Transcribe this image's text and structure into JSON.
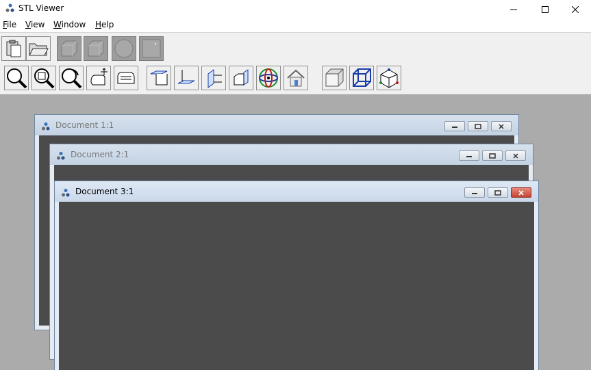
{
  "app": {
    "title": "STL Viewer"
  },
  "menu": [
    {
      "label": "File"
    },
    {
      "label": "View"
    },
    {
      "label": "Window"
    },
    {
      "label": "Help"
    }
  ],
  "toolbar1": [
    "paste-icon",
    "open-folder-icon",
    "box-gray-icon",
    "box-gray-icon",
    "sphere-gray-icon",
    "square-gray-icon"
  ],
  "toolbar2": [
    "zoom-icon",
    "zoom-window-icon",
    "zoom-dynamic-icon",
    "pan-icon",
    "rotate-hand-icon",
    "view-top-icon",
    "view-bottom-icon",
    "view-left-icon",
    "view-right-icon",
    "view-orbit-icon",
    "view-home-icon",
    "shaded-cube-icon",
    "wireframe-cube-icon",
    "axis-cube-icon"
  ],
  "documents": [
    {
      "title": "Document 1:1",
      "active": false
    },
    {
      "title": "Document 2:1",
      "active": false
    },
    {
      "title": "Document 3:1",
      "active": true
    }
  ]
}
